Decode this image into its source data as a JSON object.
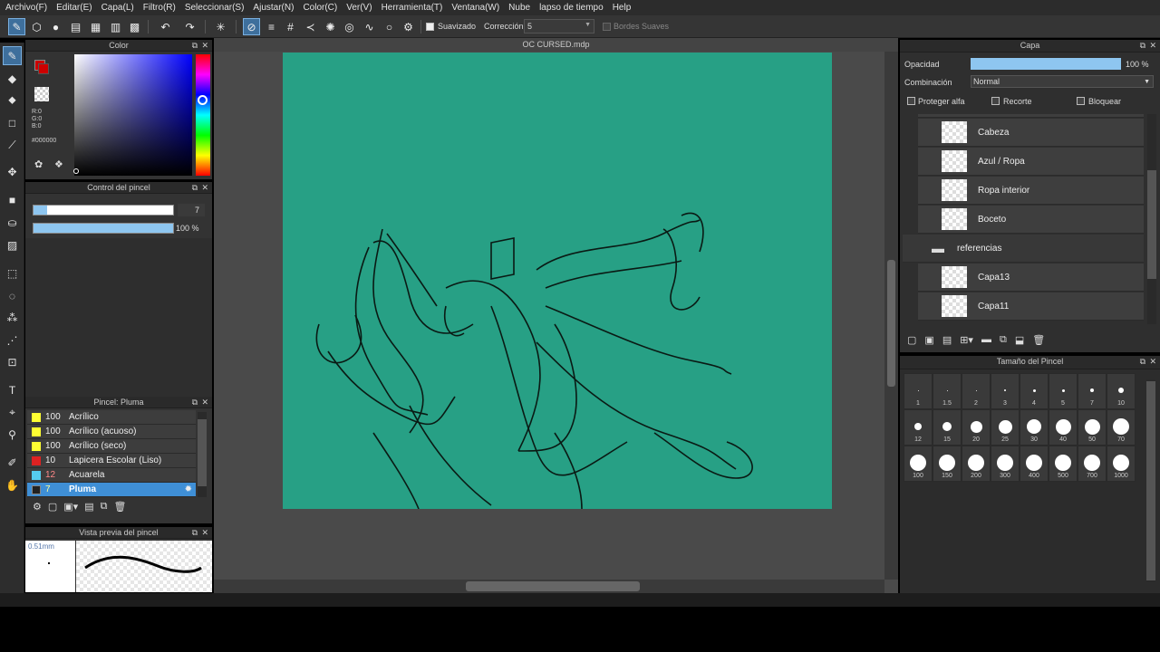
{
  "menu": [
    "Archivo(F)",
    "Editar(E)",
    "Capa(L)",
    "Filtro(R)",
    "Seleccionar(S)",
    "Ajustar(N)",
    "Color(C)",
    "Ver(V)",
    "Herramienta(T)",
    "Ventana(W)",
    "Nube",
    "lapso de tiempo",
    "Help"
  ],
  "toolbar": {
    "suavizado_label": "Suavizado",
    "correccion_label": "Corrección",
    "correccion_value": "5",
    "bordes_label": "Bordes Suaves"
  },
  "color_panel": {
    "title": "Color",
    "r": "R:0",
    "g": "G:0",
    "b": "B:0",
    "hex": "#000000",
    "fg": "#cc0000",
    "hue": "#0000ff"
  },
  "brush_control": {
    "title": "Control del pincel",
    "size": "7",
    "opacity": "100 %",
    "size_fraction": 0.1,
    "opacity_fraction": 1.0
  },
  "brush_panel": {
    "title": "Pincel: Pluma",
    "items": [
      {
        "num": "100",
        "name": "Acrílico",
        "color": "#ffff33"
      },
      {
        "num": "100",
        "name": "Acrílico (acuoso)",
        "color": "#ffff33"
      },
      {
        "num": "100",
        "name": "Acrílico (seco)",
        "color": "#ffff33"
      },
      {
        "num": "10",
        "name": "Lapicera Escolar (Liso)",
        "color": "#dd2222"
      },
      {
        "num": "12",
        "name": "Acuarela",
        "color": "#55ccee"
      },
      {
        "num": "7",
        "name": "Pluma",
        "color": "#222222"
      }
    ]
  },
  "preview_panel": {
    "title": "Vista previa del pincel",
    "size": "0.51mm"
  },
  "canvas": {
    "filename": "OC CURSED.mdp",
    "bg": "#27a085"
  },
  "layer_panel": {
    "title": "Capa",
    "opacity_label": "Opacidad",
    "opacity_value": "100 %",
    "blend_label": "Combinación",
    "blend_value": "Normal",
    "protect_alpha": "Proteger alfa",
    "clip": "Recorte",
    "lock": "Bloquear",
    "layers": [
      {
        "name": "Cabeza"
      },
      {
        "name": "Azul / Ropa"
      },
      {
        "name": "Ropa interior"
      },
      {
        "name": "Boceto"
      },
      {
        "name": "referencias",
        "folder": true
      },
      {
        "name": "Capa13"
      },
      {
        "name": "Capa11"
      }
    ]
  },
  "size_panel": {
    "title": "Tamaño del Pincel",
    "sizes": [
      "1",
      "1.5",
      "2",
      "3",
      "4",
      "5",
      "7",
      "10",
      "12",
      "15",
      "20",
      "25",
      "30",
      "40",
      "50",
      "70",
      "100",
      "150",
      "200",
      "300",
      "400",
      "500",
      "700",
      "1000"
    ]
  }
}
